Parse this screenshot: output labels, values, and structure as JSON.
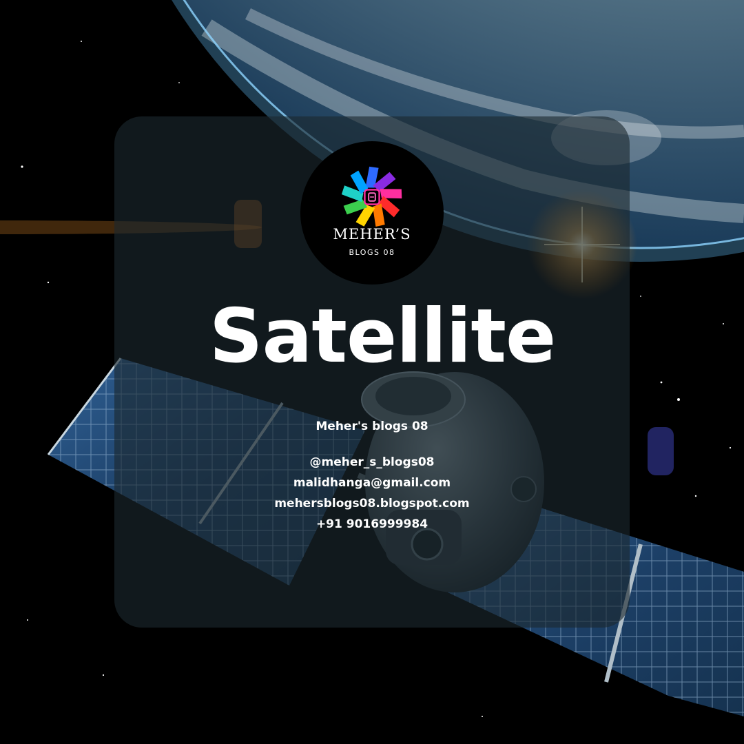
{
  "logo": {
    "title": "MEHER’S",
    "subtitle": "BLOGS 08"
  },
  "headline": "Satellite",
  "brand_name": "Meher's blogs 08",
  "contact": {
    "handle": "@meher_s_blogs08",
    "email": "malidhanga@gmail.com",
    "website": "mehersblogs08.blogspot.com",
    "phone": "+91 9016999984"
  },
  "colors": {
    "background": "#000000",
    "card": "#1c282e",
    "text": "#ffffff",
    "earth_glow": "#9fd3f0"
  },
  "icons": [
    "earth-image",
    "satellite-image",
    "logo-flower-icon",
    "lens-flare",
    "stars"
  ]
}
